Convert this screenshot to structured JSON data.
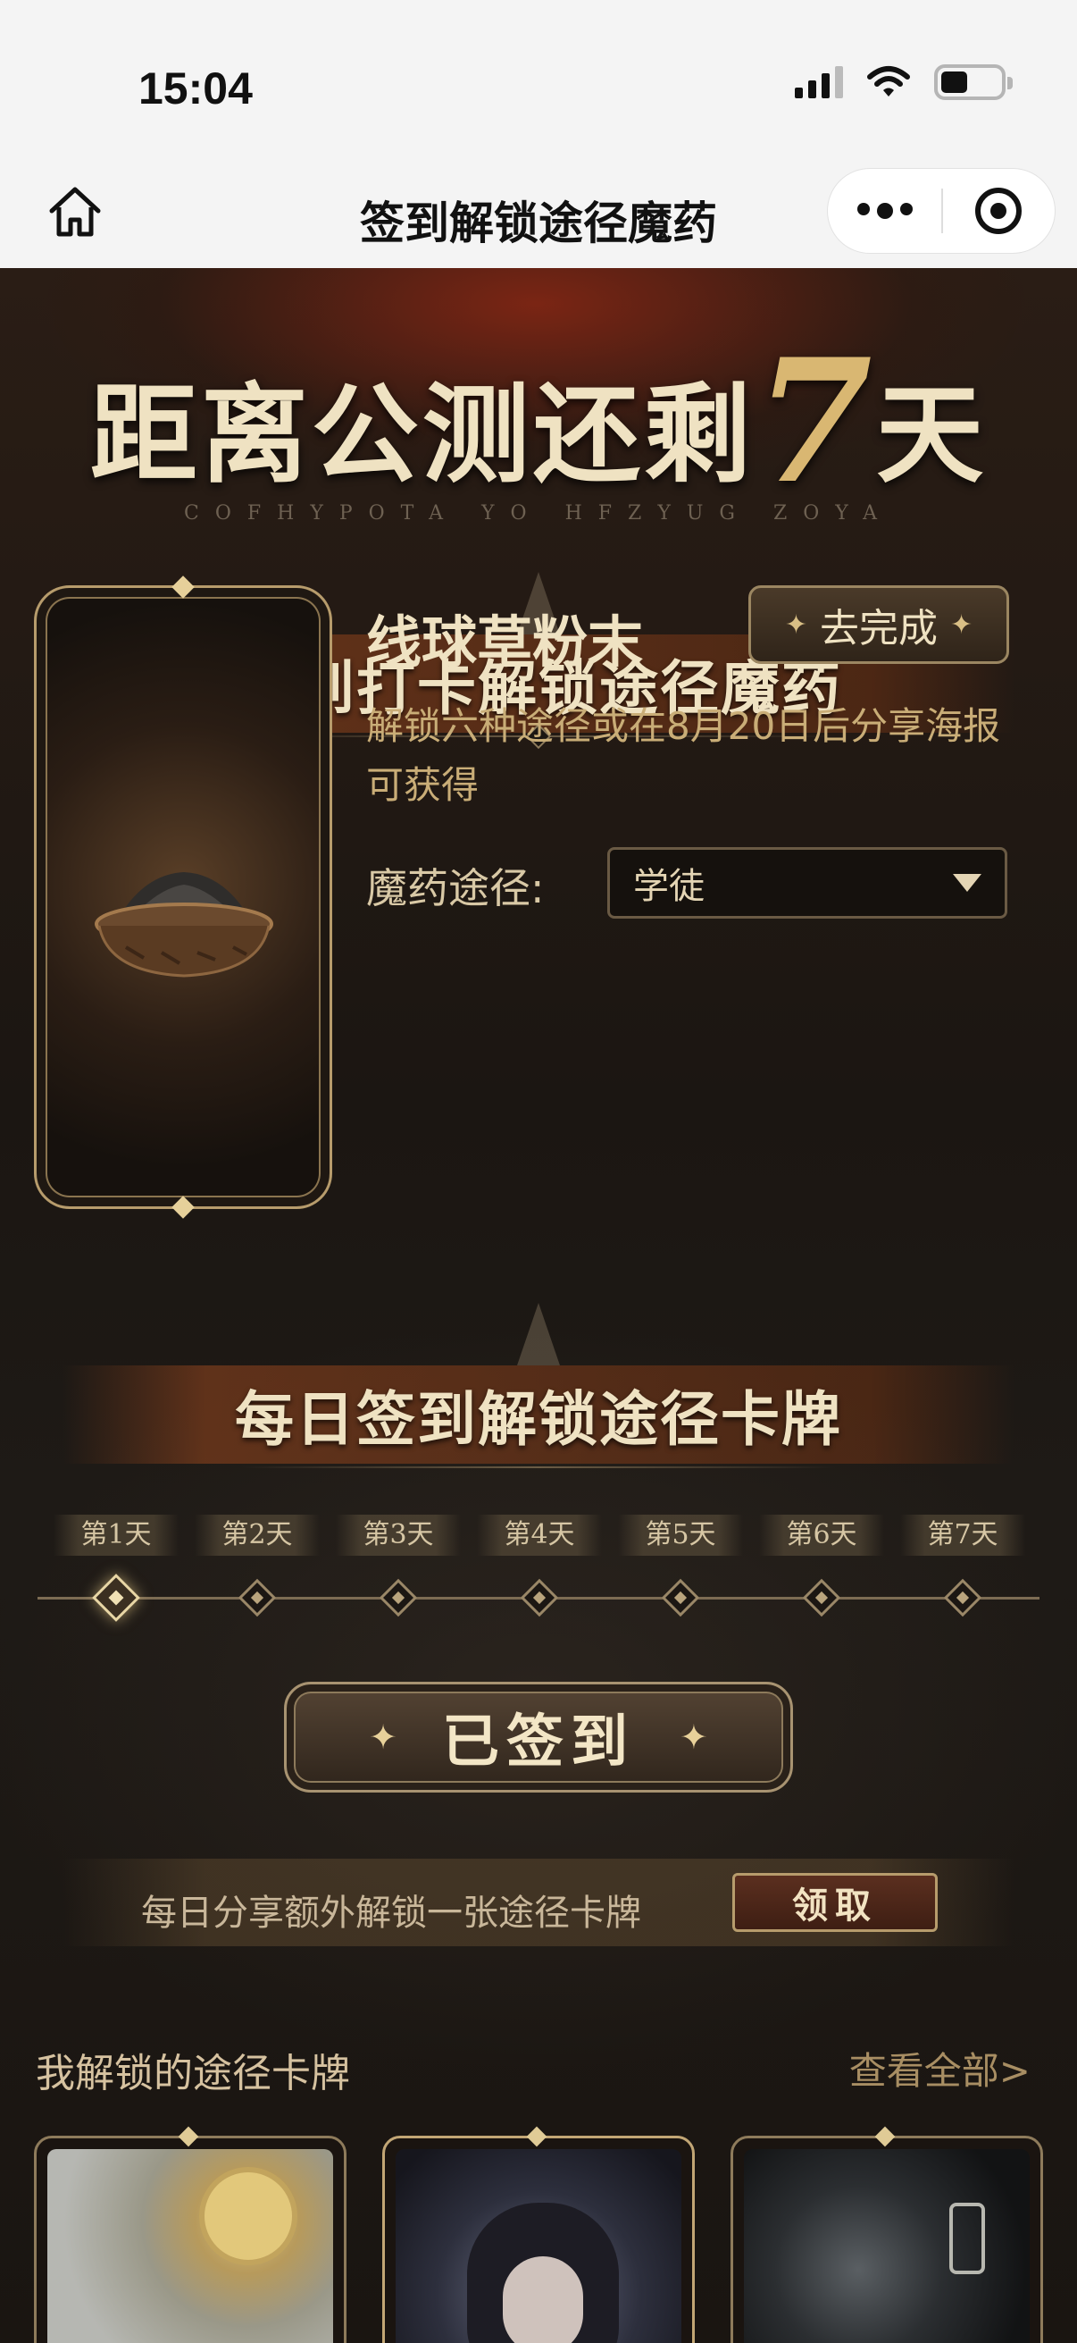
{
  "status_bar": {
    "time": "15:04"
  },
  "nav": {
    "title": "签到解锁途径魔药"
  },
  "hero": {
    "title_prefix": "距离公测还剩",
    "days_number": "7",
    "title_suffix": "天",
    "subtitle": "COFHYPOTA YO HFZYUG ZOYA"
  },
  "section1": {
    "title": "签到打卡解锁途径魔药"
  },
  "item": {
    "name": "线球草粉末",
    "action_label": "去完成",
    "description": "解锁六种途径或在8月20日后分享海报可获得",
    "path_label": "魔药途径:",
    "path_value": "学徒"
  },
  "section2": {
    "title": "每日签到解锁途径卡牌"
  },
  "days": [
    "第1天",
    "第2天",
    "第3天",
    "第4天",
    "第5天",
    "第6天",
    "第7天"
  ],
  "active_day": 1,
  "signed_button": "已签到",
  "share": {
    "text": "每日分享额外解锁一张途径卡牌",
    "claim_label": "领取"
  },
  "unlocked": {
    "title": "我解锁的途径卡牌",
    "view_all": "查看全部>"
  },
  "colors": {
    "accent_gold": "#d9b772",
    "text_light": "#efe2c2",
    "background": "#1b1612"
  }
}
